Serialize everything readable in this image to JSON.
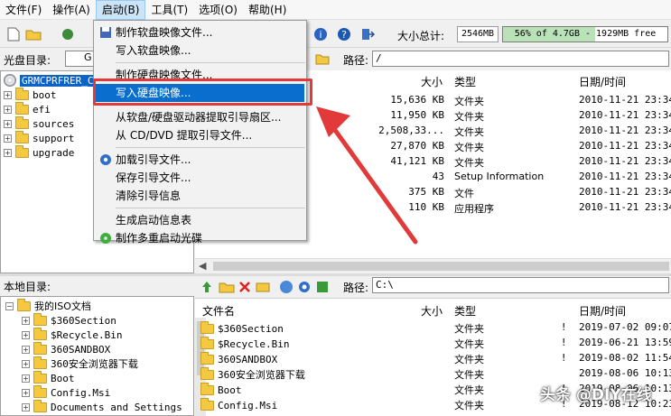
{
  "menubar": [
    "文件(F)",
    "操作(A)",
    "启动(B)",
    "工具(T)",
    "选项(O)",
    "帮助(H)"
  ],
  "toolbar": {
    "size_total_label": "大小总计:",
    "size_total_value": "2546MB",
    "size_bar_text": "56% of 4.7GB - 1929MB free",
    "size_bar_percent": 56
  },
  "cd": {
    "label": "光盘目录:",
    "combo_value": "G",
    "path_label": "路径:",
    "path_value": "/"
  },
  "upper_tree": [
    {
      "label": "GRMCPRFRER_CN",
      "selected": true,
      "root": true
    },
    {
      "label": "boot"
    },
    {
      "label": "efi"
    },
    {
      "label": "sources"
    },
    {
      "label": "support"
    },
    {
      "label": "upgrade"
    }
  ],
  "upper_cols": {
    "size": "大小",
    "type": "类型",
    "date": "日期/时间"
  },
  "upper_rows": [
    {
      "size": "15,636 KB",
      "type": "文件夹",
      "date": "2010-11-21 23:34"
    },
    {
      "size": "11,950 KB",
      "type": "文件夹",
      "date": "2010-11-21 23:34"
    },
    {
      "size": "2,508,33...",
      "type": "文件夹",
      "date": "2010-11-21 23:34"
    },
    {
      "size": "27,870 KB",
      "type": "文件夹",
      "date": "2010-11-21 23:34"
    },
    {
      "size": "41,121 KB",
      "type": "文件夹",
      "date": "2010-11-21 23:34"
    },
    {
      "size": "43",
      "type": "Setup Information",
      "date": "2010-11-21 23:34"
    },
    {
      "size": "375 KB",
      "type": "文件",
      "date": "2010-11-21 23:34"
    },
    {
      "size": "110 KB",
      "type": "应用程序",
      "date": "2010-11-21 23:34"
    }
  ],
  "local": {
    "label": "本地目录:",
    "path_label": "路径:",
    "path_value": "C:\\"
  },
  "lower_tree": [
    {
      "label": "我的ISO文档",
      "root": true
    },
    {
      "label": "$360Section"
    },
    {
      "label": "$Recycle.Bin"
    },
    {
      "label": "360SANDBOX"
    },
    {
      "label": "360安全浏览器下载"
    },
    {
      "label": "Boot"
    },
    {
      "label": "Config.Msi"
    },
    {
      "label": "Documents and Settings"
    }
  ],
  "lower_cols": {
    "name": "文件名",
    "size": "大小",
    "type": "类型",
    "date": "日期/时间"
  },
  "lower_rows": [
    {
      "name": "$360Section",
      "type": "文件夹",
      "flag": "!",
      "date": "2019-07-02 09:07"
    },
    {
      "name": "$Recycle.Bin",
      "type": "文件夹",
      "flag": "!",
      "date": "2019-06-21 13:59"
    },
    {
      "name": "360SANDBOX",
      "type": "文件夹",
      "flag": "!",
      "date": "2019-08-02 11:54"
    },
    {
      "name": "360安全浏览器下载",
      "type": "文件夹",
      "flag": "",
      "date": "2019-08-06 10:13"
    },
    {
      "name": "Boot",
      "type": "文件夹",
      "flag": "!",
      "date": "2019-08-06 10:13"
    },
    {
      "name": "Config.Msi",
      "type": "文件夹",
      "flag": "!",
      "date": "2019-08-12 10:23"
    },
    {
      "name": "",
      "type": "文件夹",
      "flag": "",
      "date": ""
    }
  ],
  "dropdown": [
    {
      "label": "制作软盘映像文件...",
      "icon": "floppy-icon"
    },
    {
      "label": "写入软盘映像..."
    },
    {
      "sep": true
    },
    {
      "label": "制作硬盘映像文件..."
    },
    {
      "label": "写入硬盘映像...",
      "highlight": true
    },
    {
      "sep": true
    },
    {
      "label": "从软盘/硬盘驱动器提取引导扇区..."
    },
    {
      "label": "从 CD/DVD 提取引导文件..."
    },
    {
      "sep": true
    },
    {
      "label": "加载引导文件...",
      "icon": "gear-icon"
    },
    {
      "label": "保存引导文件..."
    },
    {
      "label": "清除引导信息"
    },
    {
      "sep": true
    },
    {
      "label": "生成启动信息表"
    },
    {
      "label": "制作多重启动光碟",
      "icon": "green-disc-icon"
    }
  ],
  "watermark": "头条 @DIY在线"
}
